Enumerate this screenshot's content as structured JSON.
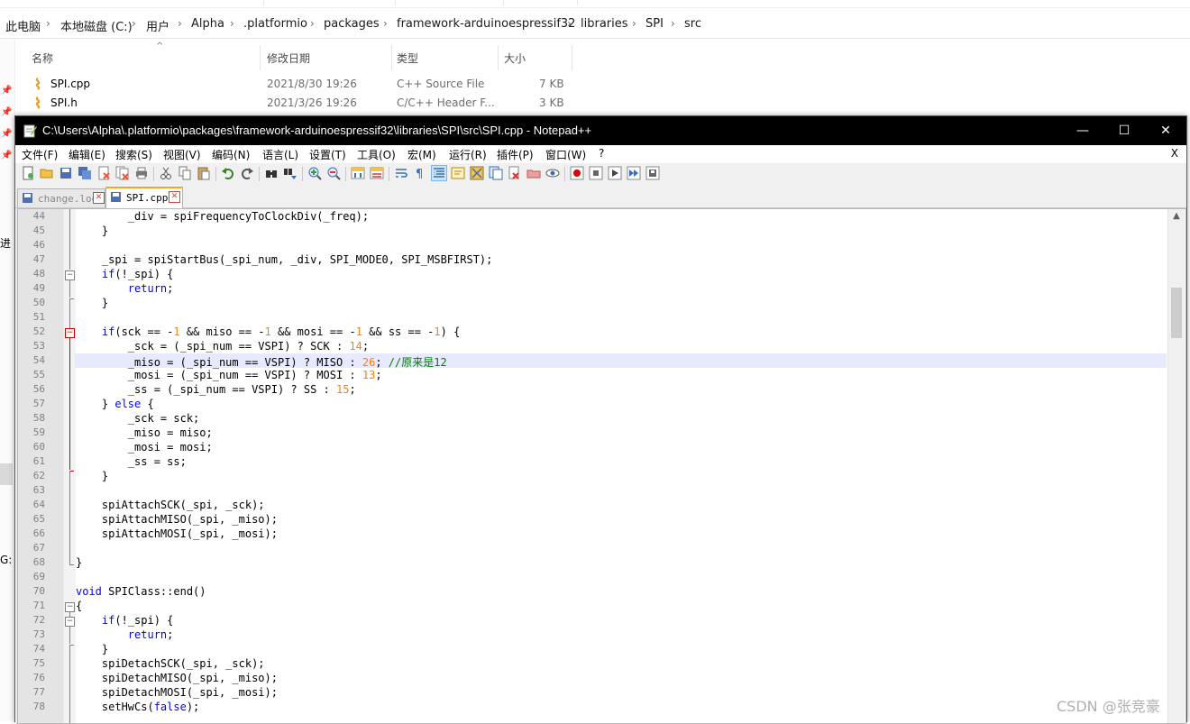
{
  "explorer": {
    "breadcrumb": [
      "此电脑",
      "本地磁盘 (C:)",
      "用户",
      "Alpha",
      ".platformio",
      "packages",
      "framework-arduinoespressif32",
      "libraries",
      "SPI",
      "src"
    ],
    "columns": {
      "name": "名称",
      "modified": "修改日期",
      "type": "类型",
      "size": "大小"
    },
    "files": [
      {
        "name": "SPI.cpp",
        "modified": "2021/8/30 19:26",
        "type": "C++ Source File",
        "size": "7 KB"
      },
      {
        "name": "SPI.h",
        "modified": "2021/3/26 19:26",
        "type": "C/C++ Header F...",
        "size": "3 KB"
      }
    ],
    "side_fragments": [
      "进",
      "G:"
    ]
  },
  "notepad": {
    "title": "C:\\Users\\Alpha\\.platformio\\packages\\framework-arduinoespressif32\\libraries\\SPI\\src\\SPI.cpp - Notepad++",
    "window_buttons": {
      "minimize": "—",
      "maximize": "☐",
      "close": "✕"
    },
    "menu": [
      "文件(F)",
      "编辑(E)",
      "搜索(S)",
      "视图(V)",
      "编码(N)",
      "语言(L)",
      "设置(T)",
      "工具(O)",
      "宏(M)",
      "运行(R)",
      "插件(P)",
      "窗口(W)",
      "?"
    ],
    "menu_close": "X",
    "toolbar_icons": [
      "new-file-icon",
      "open-file-icon",
      "save-icon",
      "save-all-icon",
      "close-icon",
      "close-all-icon",
      "print-icon",
      "cut-icon",
      "copy-icon",
      "paste-icon",
      "undo-icon",
      "redo-icon",
      "find-icon",
      "replace-icon",
      "zoom-in-icon",
      "zoom-out-icon",
      "sync-v-icon",
      "sync-h-icon",
      "word-wrap-icon",
      "show-all-chars-icon",
      "indent-guide-icon",
      "user-lang-icon",
      "doc-map-icon",
      "function-list-icon",
      "folder-workspace-icon",
      "monitor-icon",
      "record-macro-icon",
      "stop-macro-icon",
      "play-macro-icon",
      "run-multiple-macro-icon",
      "save-macro-icon"
    ],
    "tabs": [
      {
        "label": "change.log",
        "active": false
      },
      {
        "label": "SPI.cpp",
        "active": true
      }
    ],
    "code_lines": [
      {
        "n": "44",
        "tokens": [
          {
            "t": "        _div = spiFrequencyToClockDiv(_freq);",
            "c": ""
          }
        ]
      },
      {
        "n": "45",
        "tokens": [
          {
            "t": "    }",
            "c": ""
          }
        ]
      },
      {
        "n": "46",
        "tokens": []
      },
      {
        "n": "47",
        "tokens": [
          {
            "t": "    _spi = spiStartBus(_spi_num, _div, SPI_MODE0, SPI_MSBFIRST);",
            "c": ""
          }
        ]
      },
      {
        "n": "48",
        "tokens": [
          {
            "t": "    ",
            "c": ""
          },
          {
            "t": "if",
            "c": "kw"
          },
          {
            "t": "(!_spi) {",
            "c": ""
          }
        ]
      },
      {
        "n": "49",
        "tokens": [
          {
            "t": "        ",
            "c": ""
          },
          {
            "t": "return",
            "c": "kw"
          },
          {
            "t": ";",
            "c": ""
          }
        ]
      },
      {
        "n": "50",
        "tokens": [
          {
            "t": "    }",
            "c": ""
          }
        ]
      },
      {
        "n": "51",
        "tokens": []
      },
      {
        "n": "52",
        "tokens": [
          {
            "t": "    ",
            "c": ""
          },
          {
            "t": "if",
            "c": "kw"
          },
          {
            "t": "(sck == -",
            "c": ""
          },
          {
            "t": "1",
            "c": "num"
          },
          {
            "t": " && miso == -",
            "c": ""
          },
          {
            "t": "1",
            "c": "num"
          },
          {
            "t": " && mosi == -",
            "c": ""
          },
          {
            "t": "1",
            "c": "num"
          },
          {
            "t": " && ss == -",
            "c": ""
          },
          {
            "t": "1",
            "c": "num"
          },
          {
            "t": ") {",
            "c": ""
          }
        ]
      },
      {
        "n": "53",
        "tokens": [
          {
            "t": "        _sck = (_spi_num == VSPI) ? SCK : ",
            "c": ""
          },
          {
            "t": "14",
            "c": "num"
          },
          {
            "t": ";",
            "c": ""
          }
        ]
      },
      {
        "n": "54",
        "tokens": [
          {
            "t": "        _miso = (_spi_num == VSPI) ? MISO : ",
            "c": ""
          },
          {
            "t": "26",
            "c": "num"
          },
          {
            "t": "; ",
            "c": ""
          },
          {
            "t": "//原来是12",
            "c": "cmt"
          }
        ]
      },
      {
        "n": "55",
        "tokens": [
          {
            "t": "        _mosi = (_spi_num == VSPI) ? MOSI : ",
            "c": ""
          },
          {
            "t": "13",
            "c": "num"
          },
          {
            "t": ";",
            "c": ""
          }
        ]
      },
      {
        "n": "56",
        "tokens": [
          {
            "t": "        _ss = (_spi_num == VSPI) ? SS : ",
            "c": ""
          },
          {
            "t": "15",
            "c": "num"
          },
          {
            "t": ";",
            "c": ""
          }
        ]
      },
      {
        "n": "57",
        "tokens": [
          {
            "t": "    } ",
            "c": ""
          },
          {
            "t": "else",
            "c": "kw"
          },
          {
            "t": " {",
            "c": ""
          }
        ]
      },
      {
        "n": "58",
        "tokens": [
          {
            "t": "        _sck = sck;",
            "c": ""
          }
        ]
      },
      {
        "n": "59",
        "tokens": [
          {
            "t": "        _miso = miso;",
            "c": ""
          }
        ]
      },
      {
        "n": "60",
        "tokens": [
          {
            "t": "        _mosi = mosi;",
            "c": ""
          }
        ]
      },
      {
        "n": "61",
        "tokens": [
          {
            "t": "        _ss = ss;",
            "c": ""
          }
        ]
      },
      {
        "n": "62",
        "tokens": [
          {
            "t": "    }",
            "c": ""
          }
        ]
      },
      {
        "n": "63",
        "tokens": []
      },
      {
        "n": "64",
        "tokens": [
          {
            "t": "    spiAttachSCK(_spi, _sck);",
            "c": ""
          }
        ]
      },
      {
        "n": "65",
        "tokens": [
          {
            "t": "    spiAttachMISO(_spi, _miso);",
            "c": ""
          }
        ]
      },
      {
        "n": "66",
        "tokens": [
          {
            "t": "    spiAttachMOSI(_spi, _mosi);",
            "c": ""
          }
        ]
      },
      {
        "n": "67",
        "tokens": []
      },
      {
        "n": "68",
        "tokens": [
          {
            "t": "}",
            "c": ""
          }
        ]
      },
      {
        "n": "69",
        "tokens": []
      },
      {
        "n": "70",
        "tokens": [
          {
            "t": "void",
            "c": "kw"
          },
          {
            "t": " SPIClass::end()",
            "c": ""
          }
        ]
      },
      {
        "n": "71",
        "tokens": [
          {
            "t": "{",
            "c": ""
          }
        ]
      },
      {
        "n": "72",
        "tokens": [
          {
            "t": "    ",
            "c": ""
          },
          {
            "t": "if",
            "c": "kw"
          },
          {
            "t": "(!_spi) {",
            "c": ""
          }
        ]
      },
      {
        "n": "73",
        "tokens": [
          {
            "t": "        ",
            "c": ""
          },
          {
            "t": "return",
            "c": "kw"
          },
          {
            "t": ";",
            "c": ""
          }
        ]
      },
      {
        "n": "74",
        "tokens": [
          {
            "t": "    }",
            "c": ""
          }
        ]
      },
      {
        "n": "75",
        "tokens": [
          {
            "t": "    spiDetachSCK(_spi, _sck);",
            "c": ""
          }
        ]
      },
      {
        "n": "76",
        "tokens": [
          {
            "t": "    spiDetachMISO(_spi, _miso);",
            "c": ""
          }
        ]
      },
      {
        "n": "77",
        "tokens": [
          {
            "t": "    spiDetachMOSI(_spi, _mosi);",
            "c": ""
          }
        ]
      },
      {
        "n": "78",
        "tokens": [
          {
            "t": "    setHwCs(",
            "c": ""
          },
          {
            "t": "false",
            "c": "kw"
          },
          {
            "t": ");",
            "c": ""
          }
        ]
      }
    ],
    "highlighted_line": "54",
    "colors": {
      "keyword": "#0000ff",
      "number": "#ff8000",
      "comment": "#008000",
      "current_line": "#e8e8ff",
      "change_marker": "#d00000"
    }
  },
  "watermark": "CSDN @张竞豪"
}
